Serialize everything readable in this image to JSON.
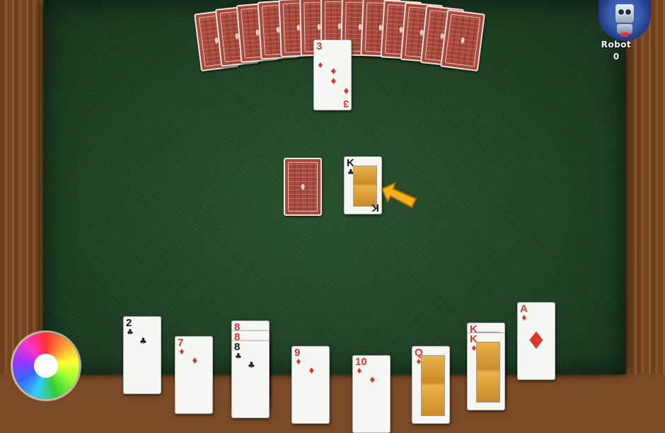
{
  "opponent": {
    "name": "Robot",
    "score": "0",
    "avatar_icon": "robot-icon"
  },
  "table": {
    "felt_color": "#244a2a",
    "card_back_color": "#a9483c"
  },
  "opponent_hand_count": 13,
  "played_card_top": {
    "rank": "3",
    "suit": "♦",
    "color": "red"
  },
  "stock_card": {
    "face": "down"
  },
  "discard_card": {
    "rank": "K",
    "suit": "♣",
    "color": "black"
  },
  "hint_arrow_icon": "pointer-arrow-icon",
  "player_hand": [
    {
      "rank": "2",
      "suit": "♣",
      "color": "black"
    },
    {
      "rank": "7",
      "suit": "♦",
      "color": "red"
    },
    {
      "rank": "8",
      "suit": "♦",
      "color": "red"
    },
    {
      "rank": "8",
      "suit": "♦",
      "color": "red"
    },
    {
      "rank": "8",
      "suit": "♣",
      "color": "black"
    },
    {
      "rank": "9",
      "suit": "♦",
      "color": "red"
    },
    {
      "rank": "10",
      "suit": "♦",
      "color": "red"
    },
    {
      "rank": "Q",
      "suit": "♦",
      "color": "red"
    },
    {
      "rank": "K",
      "suit": "♦",
      "color": "red"
    },
    {
      "rank": "K",
      "suit": "♦",
      "color": "red"
    },
    {
      "rank": "A",
      "suit": "♦",
      "color": "red"
    }
  ],
  "menu_icon": "color-wheel-icon"
}
